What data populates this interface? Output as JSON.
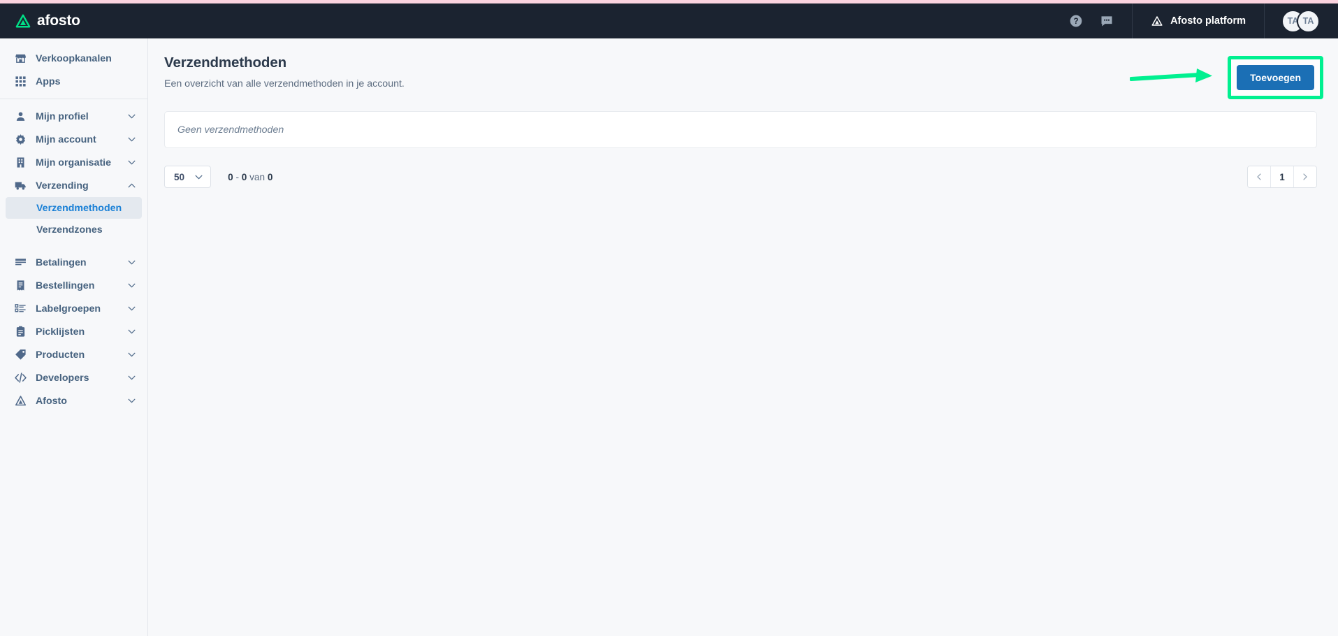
{
  "brand": {
    "name": "afosto",
    "logo_icon": "afosto-triangle-logo"
  },
  "topbar": {
    "help_icon": "question-circle-icon",
    "chat_icon": "chat-bubble-icon",
    "platform_icon": "afosto-triangle-icon",
    "platform_label": "Afosto platform",
    "avatars": [
      {
        "initials": "TA"
      },
      {
        "initials": "TA"
      }
    ]
  },
  "sidebar": {
    "top_items": [
      {
        "label": "Verkoopkanalen",
        "icon": "storefront-icon",
        "expandable": false
      },
      {
        "label": "Apps",
        "icon": "grid-apps-icon",
        "expandable": false
      }
    ],
    "items": [
      {
        "label": "Mijn profiel",
        "icon": "user-icon",
        "expandable": true,
        "expanded": false
      },
      {
        "label": "Mijn account",
        "icon": "gear-icon",
        "expandable": true,
        "expanded": false
      },
      {
        "label": "Mijn organisatie",
        "icon": "building-icon",
        "expandable": true,
        "expanded": false
      },
      {
        "label": "Verzending",
        "icon": "truck-icon",
        "expandable": true,
        "expanded": true
      },
      {
        "label": "Betalingen",
        "icon": "credit-card-icon",
        "expandable": true,
        "expanded": false
      },
      {
        "label": "Bestellingen",
        "icon": "receipt-icon",
        "expandable": true,
        "expanded": false
      },
      {
        "label": "Labelgroepen",
        "icon": "label-list-icon",
        "expandable": true,
        "expanded": false
      },
      {
        "label": "Picklijsten",
        "icon": "clipboard-icon",
        "expandable": true,
        "expanded": false
      },
      {
        "label": "Producten",
        "icon": "tag-icon",
        "expandable": true,
        "expanded": false
      },
      {
        "label": "Developers",
        "icon": "code-icon",
        "expandable": true,
        "expanded": false
      },
      {
        "label": "Afosto",
        "icon": "afosto-triangle-icon",
        "expandable": true,
        "expanded": false
      }
    ],
    "verzending_children": [
      {
        "label": "Verzendmethoden",
        "active": true
      },
      {
        "label": "Verzendzones",
        "active": false
      }
    ]
  },
  "page": {
    "title": "Verzendmethoden",
    "subtitle": "Een overzicht van alle verzendmethoden in je account.",
    "add_button_label": "Toevoegen",
    "empty_state_text": "Geen verzendmethoden"
  },
  "pagination": {
    "page_size": "50",
    "chevron_icon": "chevron-down-icon",
    "range_start": "0",
    "range_dash": "-",
    "range_end": "0",
    "range_of_word": "van",
    "range_total": "0",
    "prev_icon": "chevron-left-icon",
    "current_page": "1",
    "next_icon": "chevron-right-icon"
  },
  "annotation": {
    "arrow_color": "#00f090",
    "highlight_color": "#00f090"
  },
  "colors": {
    "topbar_bg": "#1b2330",
    "page_bg": "#f7f8fa",
    "accent_blue": "#1b6fb5",
    "active_link": "#1a80d6",
    "brand_green": "#00e087"
  }
}
